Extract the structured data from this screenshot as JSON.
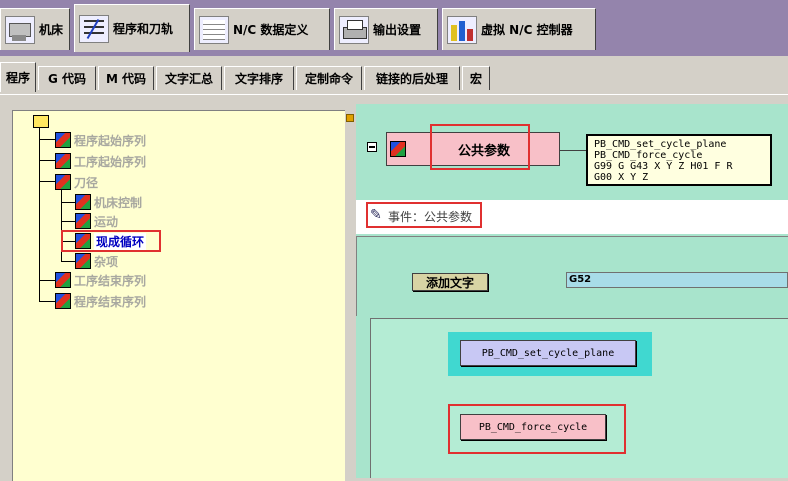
{
  "top_tabs": [
    {
      "label": "机床"
    },
    {
      "label": "程序和刀轨"
    },
    {
      "label": "N/C 数据定义"
    },
    {
      "label": "输出设置"
    },
    {
      "label": "虚拟 N/C 控制器"
    }
  ],
  "sub_tabs": [
    {
      "label": "程序"
    },
    {
      "label": "G 代码"
    },
    {
      "label": "M 代码"
    },
    {
      "label": "文字汇总"
    },
    {
      "label": "文字排序"
    },
    {
      "label": "定制命令"
    },
    {
      "label": "链接的后处理"
    },
    {
      "label": "宏"
    }
  ],
  "tree": {
    "items": [
      {
        "label": "程序起始序列"
      },
      {
        "label": "工序起始序列"
      },
      {
        "label": "刀径"
      },
      {
        "label": "机床控制"
      },
      {
        "label": "运动"
      },
      {
        "label": "现成循环"
      },
      {
        "label": "杂项"
      },
      {
        "label": "工序结束序列"
      },
      {
        "label": "程序结束序列"
      }
    ]
  },
  "event_header": {
    "title": "公共参数",
    "preview_lines": [
      "PB_CMD_set_cycle_plane",
      "PB_CMD_force_cycle",
      "G99 G G43 X Y Z H01 F R",
      "G00 X Y Z"
    ]
  },
  "event_label": "事件：公共参数",
  "add_word_button": "添加文字",
  "word_field_value": "G52",
  "blocks": [
    {
      "label": "PB_CMD_set_cycle_plane"
    },
    {
      "label": "PB_CMD_force_cycle"
    }
  ],
  "colors": {
    "highlight_red": "#e03030",
    "tree_bg": "#ffffd0",
    "panel_bg": "#a8e4cc",
    "header_bar": "#9484ac"
  }
}
